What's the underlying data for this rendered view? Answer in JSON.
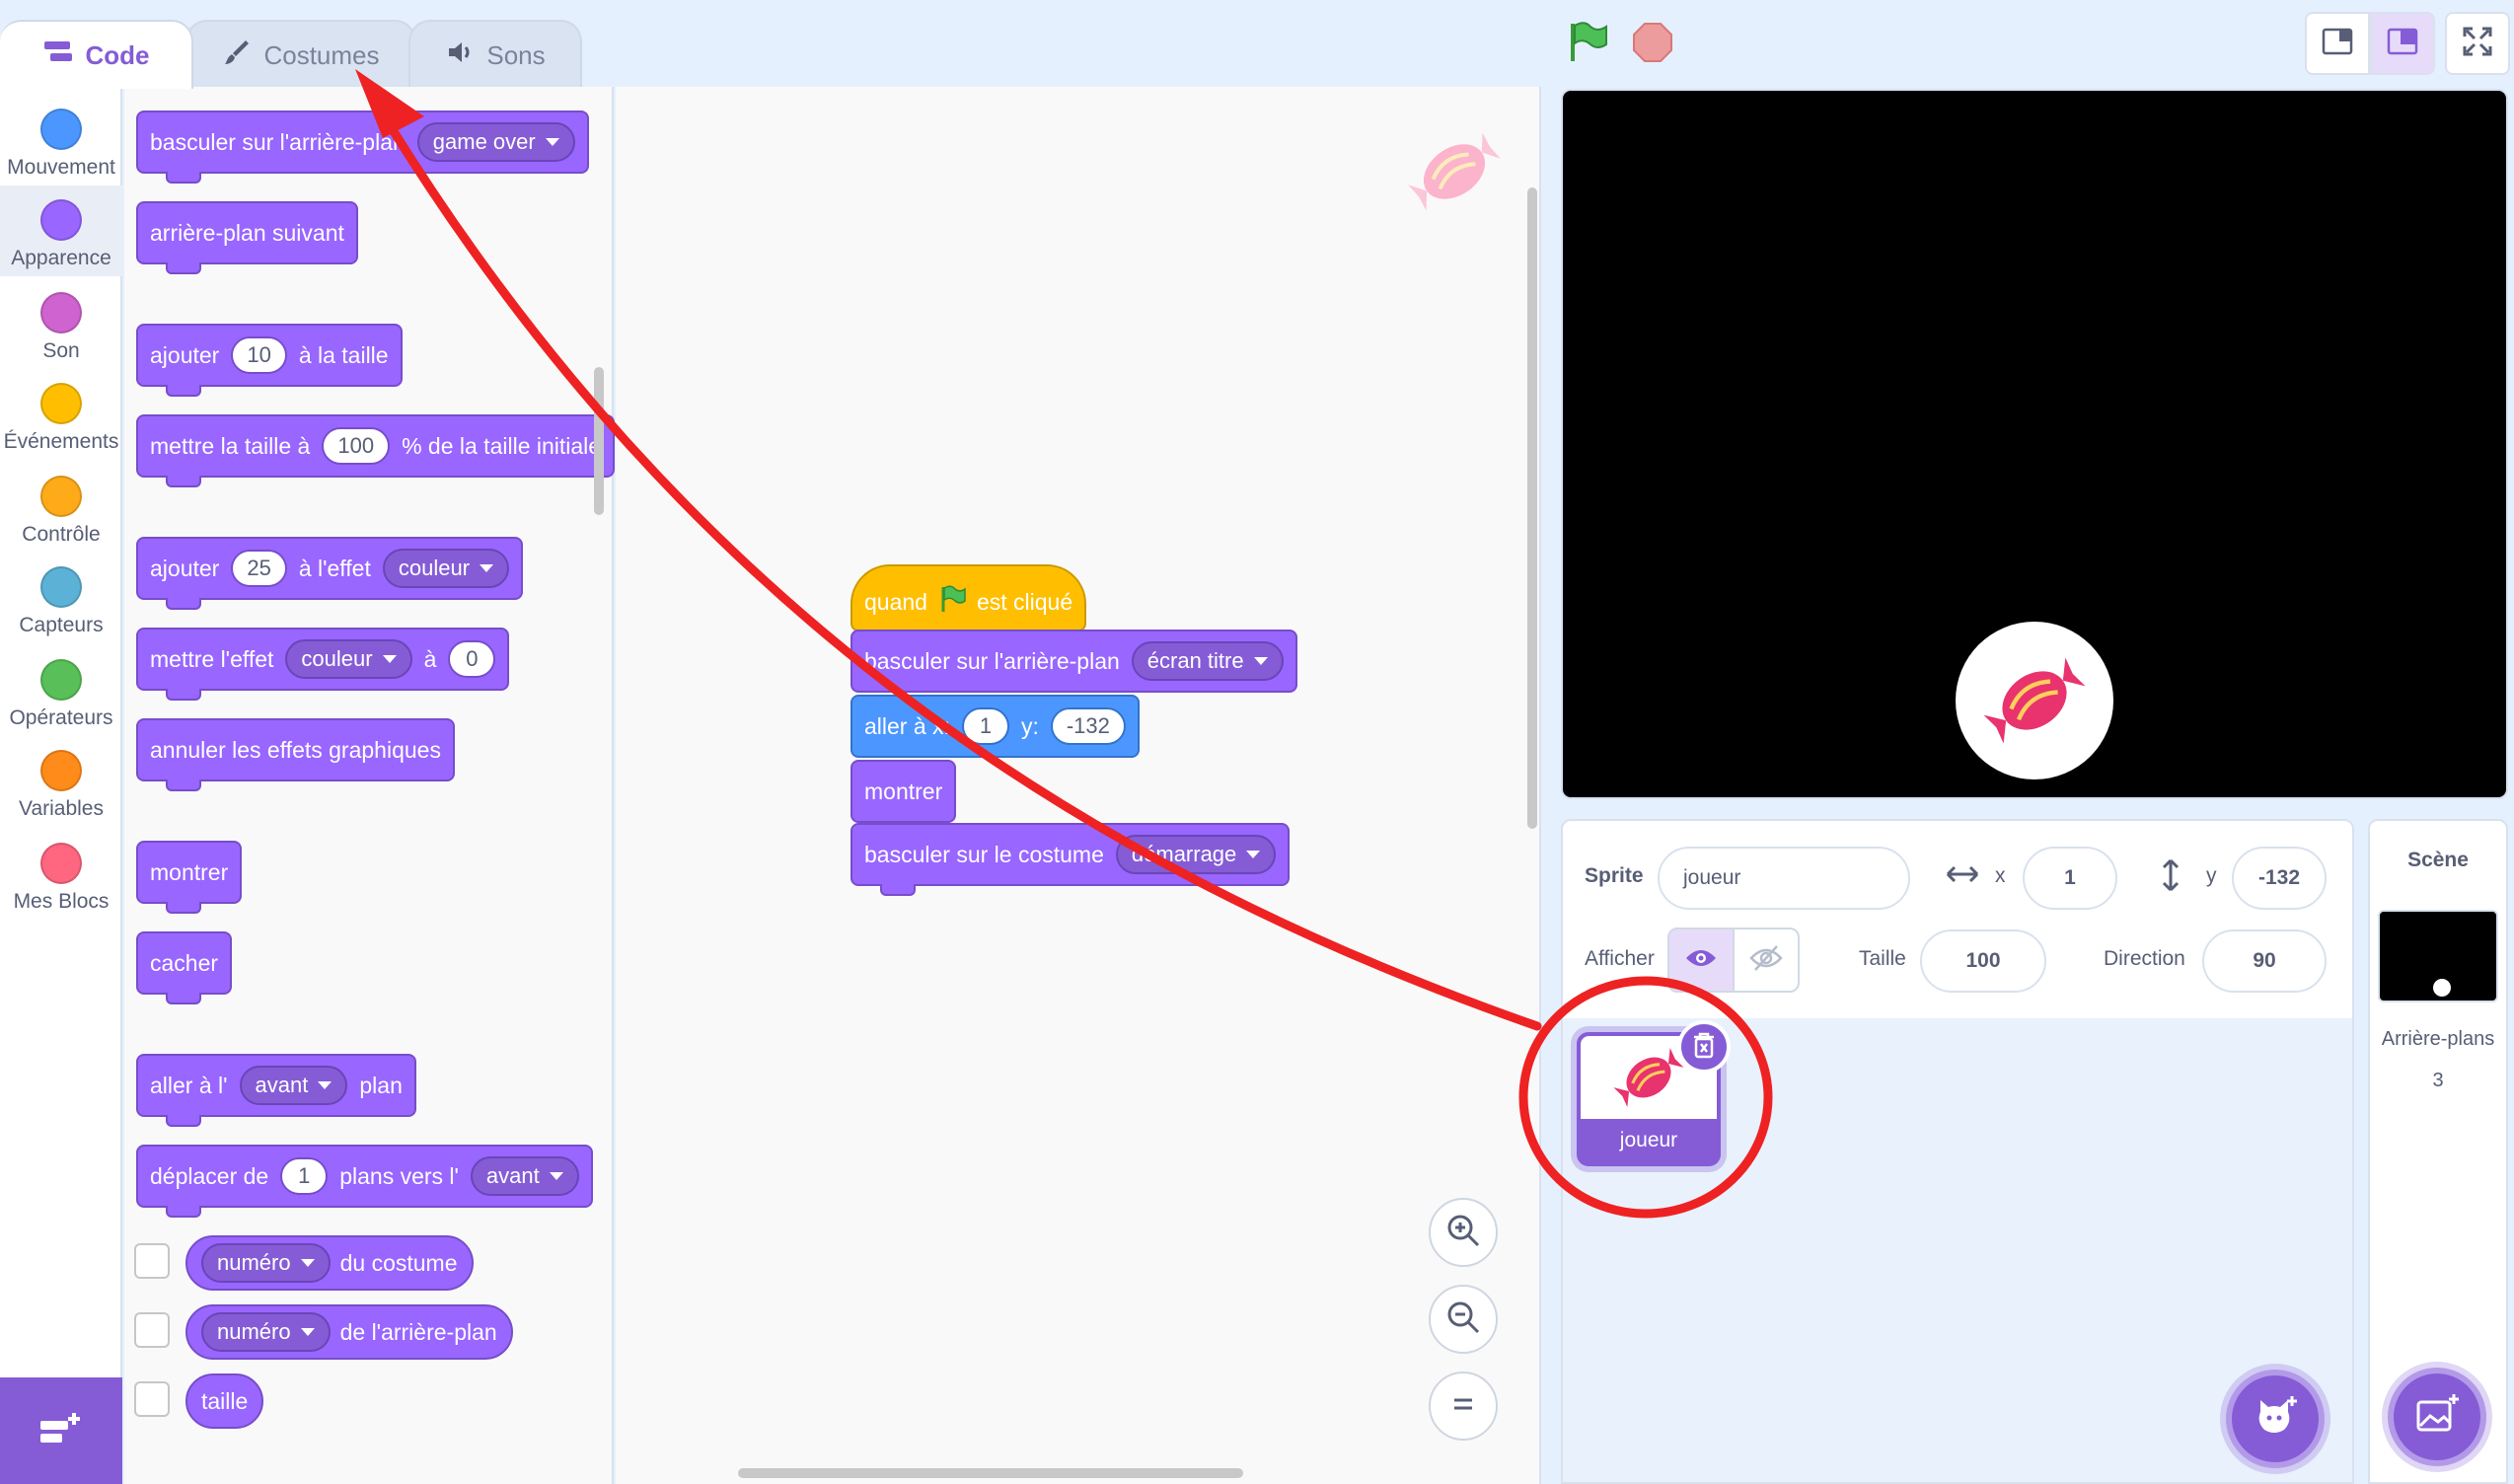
{
  "tabs": [
    {
      "label": "Code",
      "icon": "code-icon"
    },
    {
      "label": "Costumes",
      "icon": "brush-icon"
    },
    {
      "label": "Sons",
      "icon": "speaker-icon"
    }
  ],
  "categories": [
    {
      "label": "Mouvement",
      "color": "#4c97ff"
    },
    {
      "label": "Apparence",
      "color": "#9966ff"
    },
    {
      "label": "Son",
      "color": "#cf63cf"
    },
    {
      "label": "Événements",
      "color": "#ffbf00"
    },
    {
      "label": "Contrôle",
      "color": "#ffab19"
    },
    {
      "label": "Capteurs",
      "color": "#5cb1d6"
    },
    {
      "label": "Opérateurs",
      "color": "#59c059"
    },
    {
      "label": "Variables",
      "color": "#ff8c1a"
    },
    {
      "label": "Mes Blocs",
      "color": "#ff6680"
    }
  ],
  "palette": {
    "switch_backdrop": {
      "text": "basculer sur l'arrière-plan",
      "value": "game over"
    },
    "next_backdrop": "arrière-plan suivant",
    "change_size": {
      "pre": "ajouter",
      "value": "10",
      "post": "à la taille"
    },
    "set_size": {
      "pre": "mettre la taille à",
      "value": "100",
      "post": "% de la taille initiale"
    },
    "change_effect": {
      "pre": "ajouter",
      "value": "25",
      "mid": "à l'effet",
      "effect": "couleur"
    },
    "set_effect": {
      "pre": "mettre l'effet",
      "effect": "couleur",
      "mid": "à",
      "value": "0"
    },
    "clear_effects": "annuler les effets graphiques",
    "show": "montrer",
    "hide": "cacher",
    "go_to_layer": {
      "pre": "aller à l'",
      "value": "avant",
      "post": "plan"
    },
    "go_layers": {
      "pre": "déplacer de",
      "value": "1",
      "mid": "plans vers l'",
      "dir": "avant"
    },
    "costume_number": {
      "value": "numéro",
      "post": "du costume"
    },
    "backdrop_number": {
      "value": "numéro",
      "post": "de l'arrière-plan"
    },
    "size": "taille"
  },
  "script": {
    "when_flag": {
      "pre": "quand",
      "post": "est cliqué"
    },
    "switch_backdrop": {
      "text": "basculer sur l'arrière-plan",
      "value": "écran titre"
    },
    "goto": {
      "pre": "aller à x:",
      "x": "1",
      "ylabel": "y:",
      "y": "-132"
    },
    "show": "montrer",
    "switch_costume": {
      "text": "basculer sur le costume",
      "value": "démarrage"
    }
  },
  "sprite_info": {
    "sprite_label": "Sprite",
    "sprite_name": "joueur",
    "x_label": "x",
    "x": "1",
    "y_label": "y",
    "y": "-132",
    "show_label": "Afficher",
    "size_label": "Taille",
    "size": "100",
    "direction_label": "Direction",
    "direction": "90"
  },
  "sprites": [
    {
      "name": "joueur"
    }
  ],
  "stage_panel": {
    "title": "Scène",
    "backdrops_label": "Arrière-plans",
    "backdrops_count": "3"
  },
  "annotation": {
    "color": "#ee2222"
  }
}
